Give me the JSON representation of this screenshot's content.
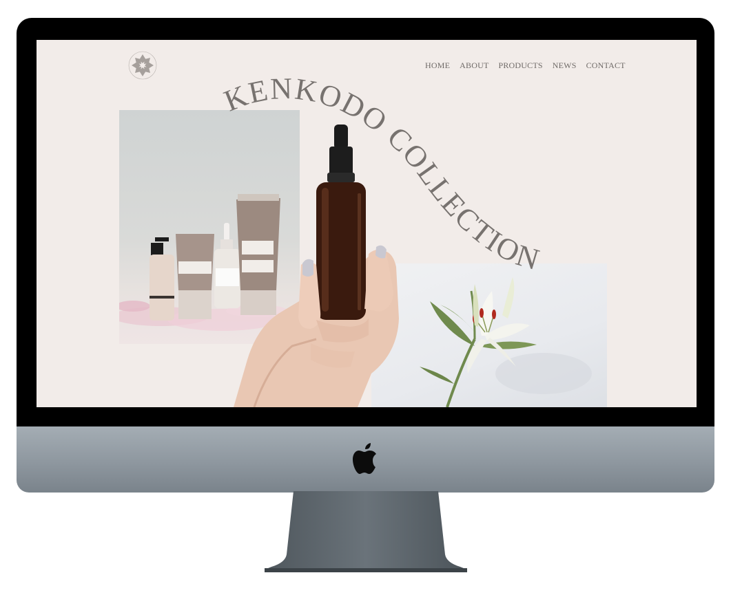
{
  "site": {
    "title": "KENKODO COLLECTION",
    "nav": [
      {
        "label": "HOME"
      },
      {
        "label": "ABOUT"
      },
      {
        "label": "PRODUCTS"
      },
      {
        "label": "NEWS"
      },
      {
        "label": "CONTACT"
      }
    ]
  },
  "icons": {
    "logo": "snowflake-emblem-icon",
    "device": "apple-logo-icon"
  },
  "colors": {
    "page_background": "#f2ece9",
    "title_text": "#77726f",
    "nav_text": "#6f6a67",
    "bezel": "#000000",
    "chin": "#8e979f",
    "bottle_glass": "#3a1a0e"
  }
}
